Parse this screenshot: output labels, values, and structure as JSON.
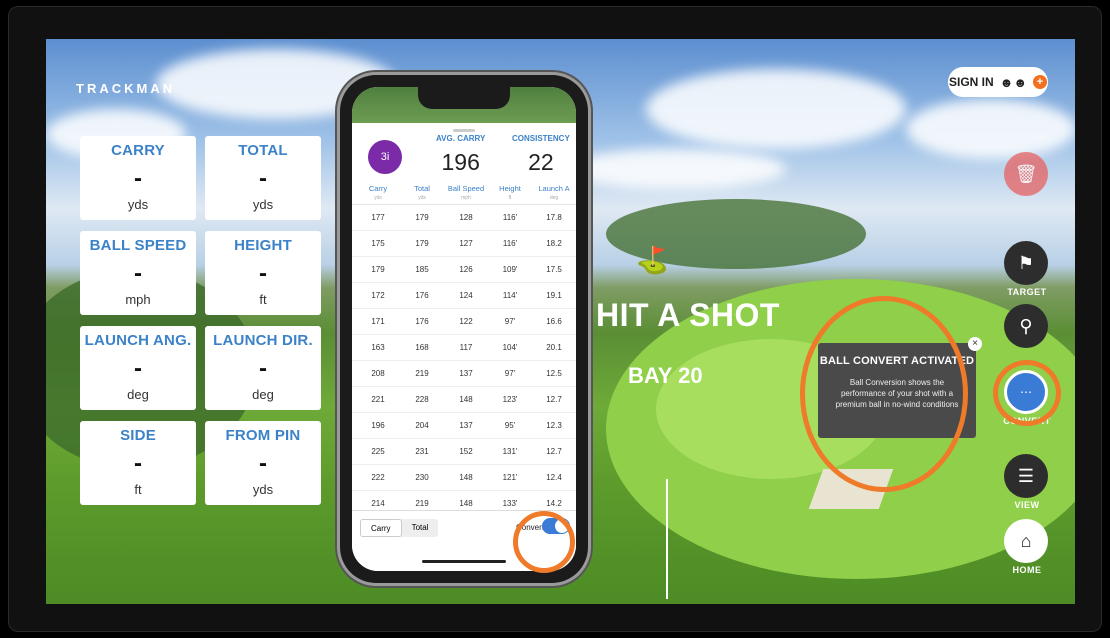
{
  "app": {
    "brand": "TRACKMAN",
    "sign_in": "SIGN IN"
  },
  "tiles": [
    {
      "title": "CARRY",
      "value": "-",
      "unit": "yds"
    },
    {
      "title": "TOTAL",
      "value": "-",
      "unit": "yds"
    },
    {
      "title": "BALL SPEED",
      "value": "-",
      "unit": "mph"
    },
    {
      "title": "HEIGHT",
      "value": "-",
      "unit": "ft"
    },
    {
      "title": "LAUNCH ANG.",
      "value": "-",
      "unit": "deg"
    },
    {
      "title": "LAUNCH DIR.",
      "value": "-",
      "unit": "deg"
    },
    {
      "title": "SIDE",
      "value": "-",
      "unit": "ft"
    },
    {
      "title": "FROM PIN",
      "value": "-",
      "unit": "yds"
    }
  ],
  "center": {
    "hit": "HIT A SHOT",
    "bay": "BAY 20"
  },
  "right_menu": {
    "target": "TARGET",
    "convert": "CONVERT",
    "view": "VIEW",
    "home": "HOME"
  },
  "popup": {
    "title": "BALL CONVERT ACTIVATED",
    "body": "Ball Conversion shows the performance of your shot with a premium ball in no-wind conditions"
  },
  "phone": {
    "club": "3i",
    "avg_carry_label": "AVG. CARRY",
    "avg_carry": "196",
    "consistency_label": "CONSISTENCY",
    "consistency": "22",
    "columns": [
      {
        "name": "Carry",
        "unit": "yds"
      },
      {
        "name": "Total",
        "unit": "yds"
      },
      {
        "name": "Ball Speed",
        "unit": "mph"
      },
      {
        "name": "Height",
        "unit": "ft"
      },
      {
        "name": "Launch A",
        "unit": "deg"
      }
    ],
    "rows": [
      [
        "177",
        "179",
        "128",
        "116'",
        "17.8"
      ],
      [
        "175",
        "179",
        "127",
        "116'",
        "18.2"
      ],
      [
        "179",
        "185",
        "126",
        "109'",
        "17.5"
      ],
      [
        "172",
        "176",
        "124",
        "114'",
        "19.1"
      ],
      [
        "171",
        "176",
        "122",
        "97'",
        "16.6"
      ],
      [
        "163",
        "168",
        "117",
        "104'",
        "20.1"
      ],
      [
        "208",
        "219",
        "137",
        "97'",
        "12.5"
      ],
      [
        "221",
        "228",
        "148",
        "123'",
        "12.7"
      ],
      [
        "196",
        "204",
        "137",
        "95'",
        "12.3"
      ],
      [
        "225",
        "231",
        "152",
        "131'",
        "12.7"
      ],
      [
        "222",
        "230",
        "148",
        "121'",
        "12.4"
      ],
      [
        "214",
        "219",
        "148",
        "133'",
        "14.2"
      ]
    ],
    "seg_carry": "Carry",
    "seg_total": "Total",
    "convert_label": "Convert",
    "convert_on": true
  },
  "colors": {
    "accent": "#3c82c8",
    "orange": "#ee7a2a",
    "club_badge": "#7b2aa8"
  }
}
